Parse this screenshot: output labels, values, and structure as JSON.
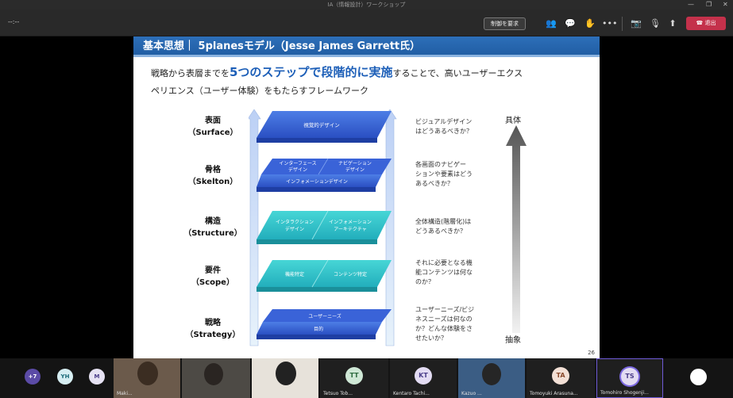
{
  "window": {
    "title": "IA（情報設計）ワークショップ"
  },
  "toolbar": {
    "timer": "--:--",
    "request_control_label": "制御を要求",
    "leave_label": "退出",
    "more_label": "•••"
  },
  "slide": {
    "header": "基本思想｜ 5planesモデル（Jesse James Garrett氏）",
    "lead_prefix": "戦略から表層までを",
    "lead_highlight": "5つのステップで段階的に実施",
    "lead_suffix_line1": "することで、高いユーザーエクス",
    "lead_line2": "ペリエンス（ユーザー体験）をもたらすフレームワーク",
    "levels": [
      {
        "jp": "表面",
        "en": "（Surface）",
        "desc": [
          "ビジュアルデザイン",
          "はどうあるべきか？"
        ]
      },
      {
        "jp": "骨格",
        "en": "（Skelton）",
        "desc": [
          "各画面のナビゲー",
          "ションや要素はどう",
          "あるべきか？"
        ]
      },
      {
        "jp": "構造",
        "en": "（Structure）",
        "desc": [
          "全体構造(階層化)は",
          "どうあるべきか？"
        ]
      },
      {
        "jp": "要件",
        "en": "（Scope）",
        "desc": [
          "それに必要となる機",
          "能コンテンツは何な",
          "のか？"
        ]
      },
      {
        "jp": "戦略",
        "en": "（Strategy）",
        "desc": [
          "ユーザーニーズ/ビジ",
          "ネスニーズは何なの",
          "か？どんな体験をさ",
          "せたいか？"
        ]
      }
    ],
    "planes": {
      "surface": [
        "視覚的デザイン"
      ],
      "skeleton": [
        "インターフェース",
        "デザイン",
        "ナビゲーション",
        "デザイン",
        "インフォメーションデザイン"
      ],
      "structure": [
        "インタラクション",
        "デザイン",
        "インフォメーション",
        "アーキテクチャ"
      ],
      "scope": [
        "機能特定",
        "コンテンツ特定"
      ],
      "strategy": [
        "ユーザーニーズ",
        "目的"
      ]
    },
    "concrete_label": "具体",
    "abstract_label": "抽象",
    "page_number": "26"
  },
  "participants": {
    "overflow": "+7",
    "tiles": [
      {
        "initials": "YH",
        "name": ""
      },
      {
        "initials": "M",
        "name": ""
      },
      {
        "initials": "",
        "name": "Maki..."
      },
      {
        "initials": "",
        "name": ""
      },
      {
        "initials": "",
        "name": ""
      },
      {
        "initials": "TT",
        "name": "Tetsuo Tob..."
      },
      {
        "initials": "KT",
        "name": "Kentaro Tachi..."
      },
      {
        "initials": "",
        "name": "Kazuo ..."
      },
      {
        "initials": "TA",
        "name": "Tomoyuki Arasuna..."
      },
      {
        "initials": "TS",
        "name": "Tomohiro Shogenji..."
      }
    ]
  },
  "colors": {
    "accent_blue": "#2d6fb9",
    "leave_red": "#c4314b",
    "teal": "#2ec4c4",
    "plane_blue": "#3a63d8"
  }
}
